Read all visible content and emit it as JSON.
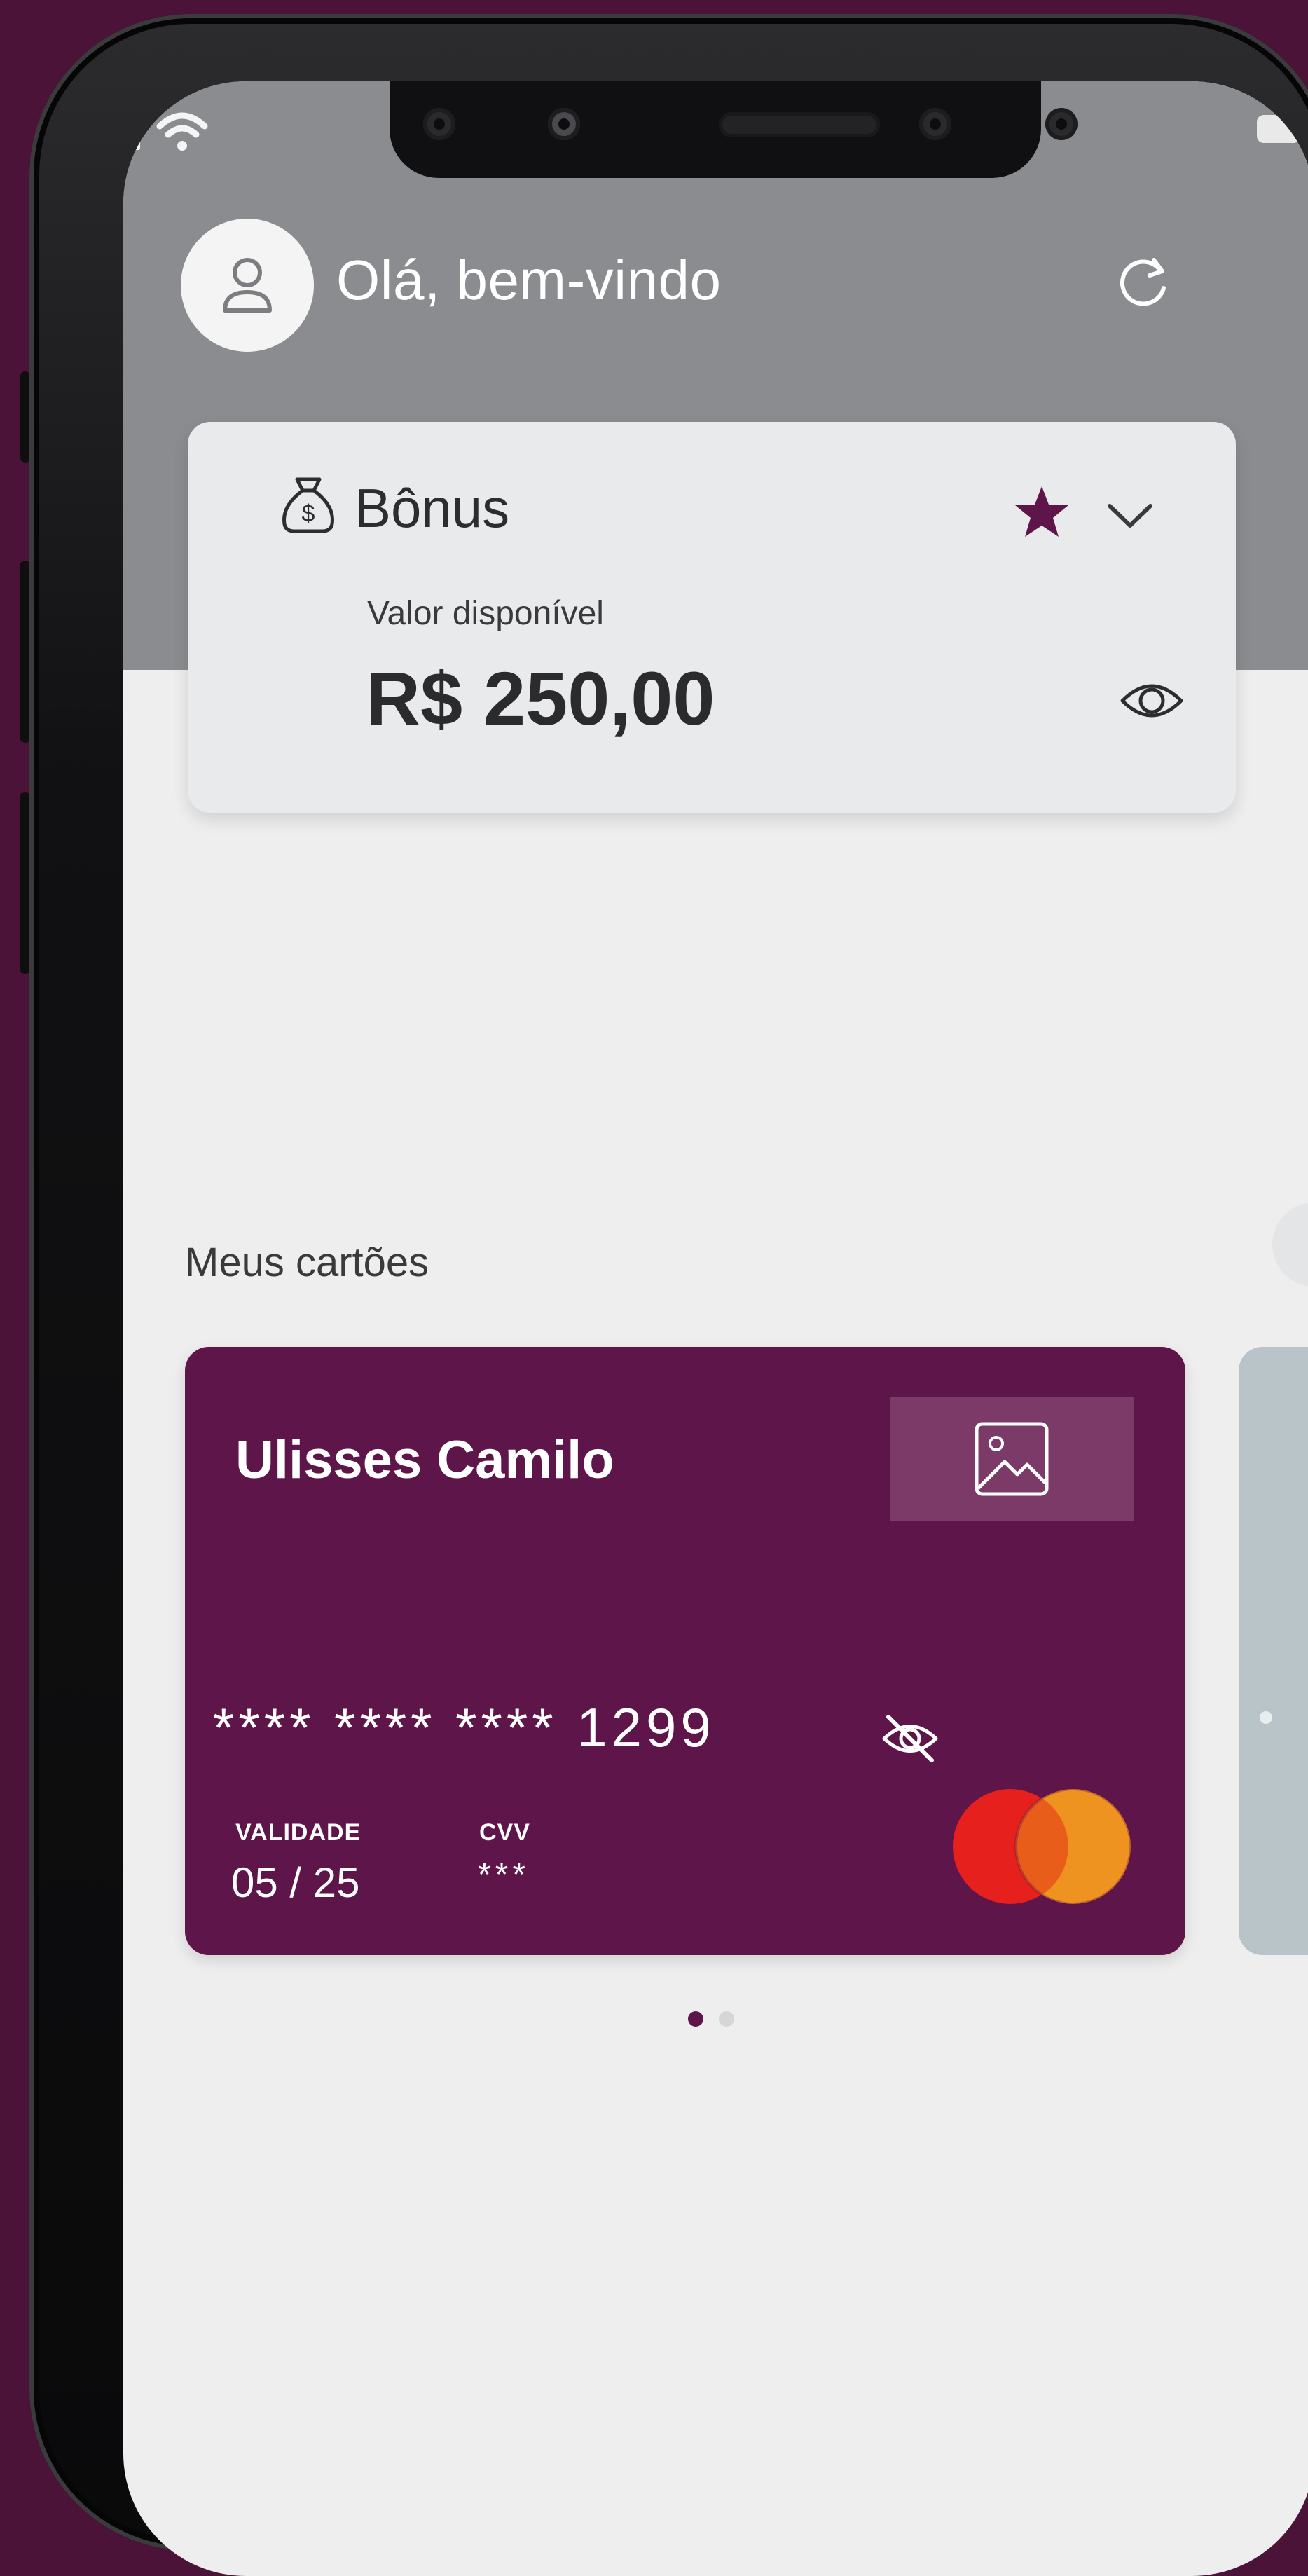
{
  "header": {
    "greeting": "Olá, bem-vindo"
  },
  "bonus": {
    "title": "Bônus",
    "available_label": "Valor disponível",
    "available_value": "R$ 250,00"
  },
  "cards_section": {
    "title": "Meus cartões"
  },
  "card": {
    "holder_name": "Ulisses Camilo",
    "number_masked": "**** **** **** 1299",
    "expiry_label": "VALIDADE",
    "expiry_value": "05 / 25",
    "cvv_label": "CVV",
    "cvv_value": "***"
  },
  "carousel": {
    "page_count": 2,
    "current_page": 1
  },
  "icons": {
    "status_signal": "signal-icon",
    "status_wifi": "wifi-icon",
    "status_battery": "battery-icon",
    "avatar": "user-icon",
    "refresh": "refresh-icon",
    "bonus": "money-bag-icon",
    "favorite": "star-icon",
    "expand": "chevron-down-icon",
    "show_balance": "eye-icon",
    "card_image": "image-icon",
    "hide_number": "eye-off-icon",
    "card_brand": "mastercard-logo"
  },
  "colors": {
    "background": "#4b1338",
    "header_band": "#8a8c8f",
    "screen": "#eeeeee",
    "card_primary": "#5e1549",
    "accent": "#5e1549",
    "mastercard_red": "#e5201d",
    "mastercard_orange": "#ef9320"
  }
}
